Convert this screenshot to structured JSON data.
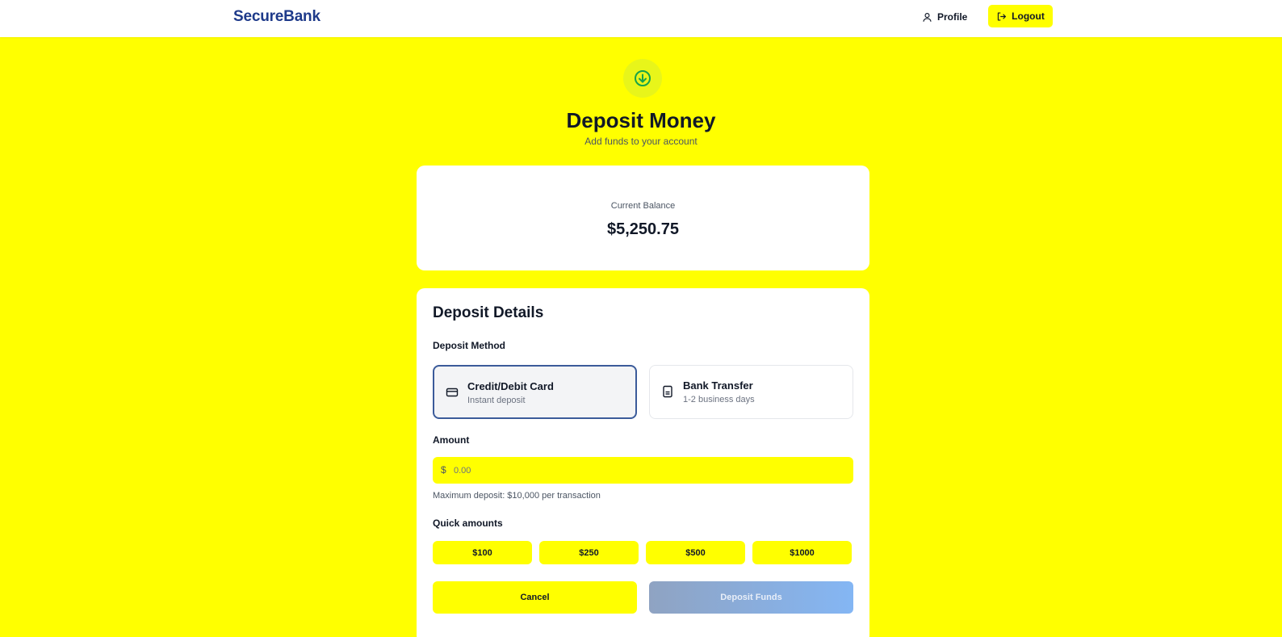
{
  "header": {
    "brand": "SecureBank",
    "profile_label": "Profile",
    "logout_label": "Logout"
  },
  "hero": {
    "icon": "arrow-down-circle-icon",
    "title": "Deposit Money",
    "subtitle": "Add funds to your account"
  },
  "balance": {
    "label": "Current Balance",
    "value": "$5,250.75"
  },
  "details": {
    "title": "Deposit Details",
    "method_label": "Deposit Method",
    "methods": [
      {
        "title": "Credit/Debit Card",
        "subtitle": "Instant deposit",
        "icon": "credit-card-icon",
        "selected": true
      },
      {
        "title": "Bank Transfer",
        "subtitle": "1-2 business days",
        "icon": "bank-icon",
        "selected": false
      }
    ],
    "amount_label": "Amount",
    "amount_prefix": "$",
    "amount_placeholder": "0.00",
    "amount_value": "",
    "amount_hint": "Maximum deposit: $10,000 per transaction",
    "quick_label": "Quick amounts",
    "quick_amounts": [
      "$100",
      "$250",
      "$500",
      "$1000"
    ],
    "cancel_label": "Cancel",
    "deposit_label": "Deposit Funds"
  },
  "colors": {
    "background": "#ffff00",
    "brand": "#1e3a8a",
    "selected_border": "#3b5b9a",
    "icon_green": "#16a34a",
    "deposit_gradient_start": "#8fa3c2",
    "deposit_gradient_end": "#84b6f4"
  }
}
